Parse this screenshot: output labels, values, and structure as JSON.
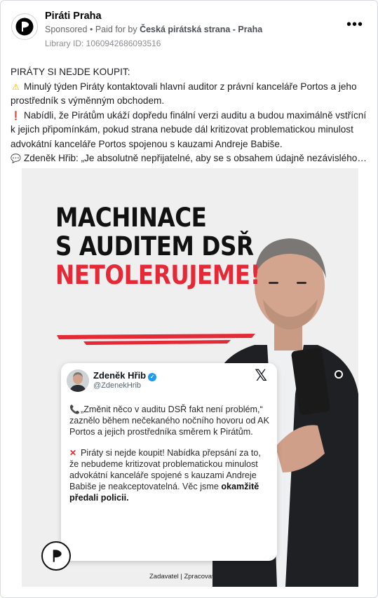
{
  "post": {
    "page_name": "Piráti Praha",
    "sponsored": "Sponsored",
    "paid_by_prefix": "Paid for by",
    "paid_by": "Česká pirátská strana - Praha",
    "separator": "•",
    "library_id": "Library ID: 1060942686093516",
    "more_icon": "more-horizontal-icon",
    "more_glyph": "•••"
  },
  "body": {
    "line1": "PIRÁTY SI NEJDE KOUPIT:",
    "para1": "Minulý týden Piráty kontaktovali hlavní auditor z právní kanceláře Portos a jeho prostředník s výměnným obchodem.",
    "para2": "Nabídli, že Pirátům ukáží dopředu finální verzi auditu a budou maximálně vstřícní k jejich připomínkám, pokud strana nebude dál kritizovat problematickou minulost advokátní kanceláře Portos spojenou s kauzami Andreje Babiše.",
    "para3": "Zdeněk Hřib: „Je absolutně nepřijatelné, aby se s obsahem údajně nezávislého…",
    "emoji1": "⚠",
    "emoji2": "❗",
    "emoji3": "💬"
  },
  "creative": {
    "headline1": "MACHINACE",
    "headline2": "S AUDITEM DSŘ",
    "headline3": "NETOLERUJEME!",
    "footer": "Zadavatel | Zpracovatel: Piráti",
    "tweet": {
      "name": "Zdeněk Hřib",
      "handle": "@ZdenekHrib",
      "x_logo": "𝕏",
      "verified": "✓",
      "emoji_phone": "📞",
      "emoji_cross": "✕",
      "para1": "„Změnit něco v auditu DSŘ fakt není problém,“ zaznělo během nečekaného nočního hovoru od AK Portos a jejich prostředníka směrem k Pirátům.",
      "para2_main": "Piráty si nejde koupit! Nabídka přepsání za to, že nebudeme kritizovat problematickou minulost advokátní kanceláře spojené s kauzami Andreje Babiše je neakceptovatelná. Věc jsme",
      "para2_bold": "okamžitě předali policii."
    }
  },
  "colors": {
    "accent_red": "#e32a36",
    "verified_blue": "#1d9bf0",
    "meta_gray": "#65676b"
  }
}
